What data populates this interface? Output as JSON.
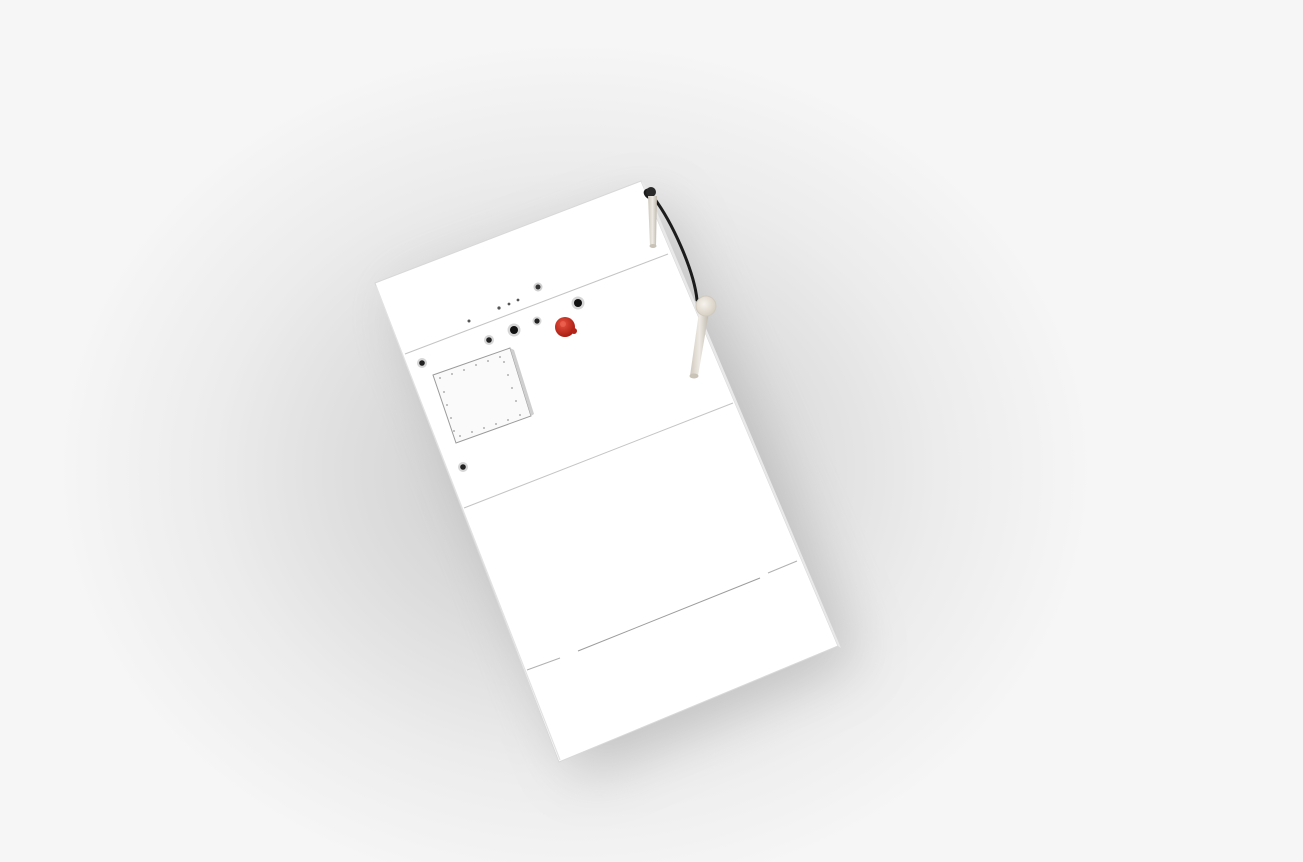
{
  "scene": {
    "background_color": "#e6e6e6",
    "cabinet_color": "#ffffff",
    "button_color": "#cc2a1e",
    "pipe_color": "#e2ddd6",
    "cable_color": "#1c1c1c"
  }
}
